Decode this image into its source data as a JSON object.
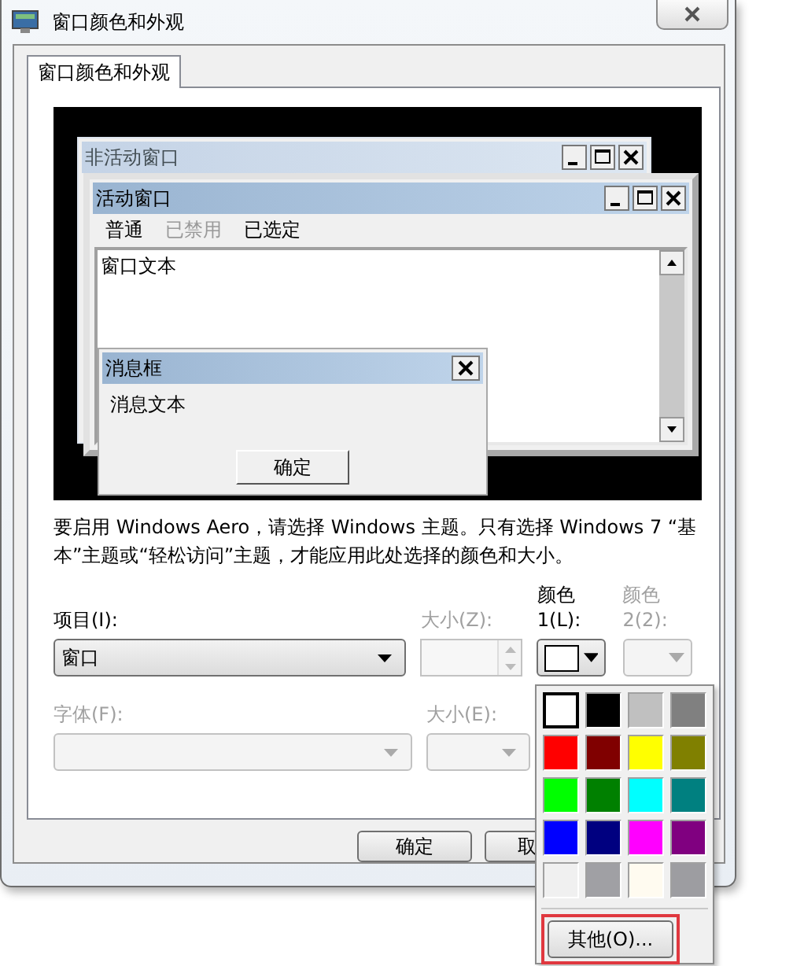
{
  "window": {
    "title": "窗口颜色和外观"
  },
  "tabs": [
    {
      "label": "窗口颜色和外观",
      "selected": true
    }
  ],
  "preview": {
    "inactive_window": {
      "title": "非活动窗口"
    },
    "active_window": {
      "title": "活动窗口",
      "menu": [
        {
          "label": "普通",
          "disabled": false
        },
        {
          "label": "已禁用",
          "disabled": true
        },
        {
          "label": "已选定",
          "disabled": false
        }
      ],
      "text": "窗口文本"
    },
    "message_box": {
      "title": "消息框",
      "text": "消息文本",
      "button": "确定"
    }
  },
  "description": "要启用 Windows Aero，请选择 Windows 主题。只有选择 Windows 7 “基本”主题或“轻松访问”主题，才能应用此处选择的颜色和大小。",
  "item_row": [
    {
      "kind": "dropdown",
      "label": "项目(I):",
      "value": "窗口",
      "disabled": false
    },
    {
      "kind": "spinner",
      "label": "大小(Z):",
      "disabled": true
    },
    {
      "kind": "color",
      "label": "颜色 1(L):",
      "disabled": false
    },
    {
      "kind": "color",
      "label": "颜色 2(2):",
      "disabled": true
    }
  ],
  "font_row": [
    {
      "kind": "dropdown",
      "label": "字体(F):",
      "disabled": true
    },
    {
      "kind": "spinner",
      "label": "大小(E):",
      "disabled": true
    }
  ],
  "buttons": [
    {
      "label": "确定"
    },
    {
      "label": "取"
    }
  ],
  "color_popup": {
    "swatches": [
      {
        "color": "#ffffff",
        "selected": true
      },
      {
        "color": "#000000",
        "selected": false
      },
      {
        "color": "#c0c0c0",
        "selected": false
      },
      {
        "color": "#808080",
        "selected": false
      },
      {
        "color": "#ff0000",
        "selected": false
      },
      {
        "color": "#800000",
        "selected": false
      },
      {
        "color": "#ffff00",
        "selected": false
      },
      {
        "color": "#808000",
        "selected": false
      },
      {
        "color": "#00ff00",
        "selected": false
      },
      {
        "color": "#008000",
        "selected": false
      },
      {
        "color": "#00ffff",
        "selected": false
      },
      {
        "color": "#008080",
        "selected": false
      },
      {
        "color": "#0000ff",
        "selected": false
      },
      {
        "color": "#000080",
        "selected": false
      },
      {
        "color": "#ff00ff",
        "selected": false
      },
      {
        "color": "#800080",
        "selected": false
      },
      {
        "color": "#f0f0f0",
        "selected": false
      },
      {
        "color": "#a0a0a4",
        "selected": false
      },
      {
        "color": "#fffbf0",
        "selected": false
      },
      {
        "color": "#9d9da1",
        "selected": false
      }
    ],
    "other_button": {
      "label": "其他(O)...",
      "highlighted": true
    }
  }
}
